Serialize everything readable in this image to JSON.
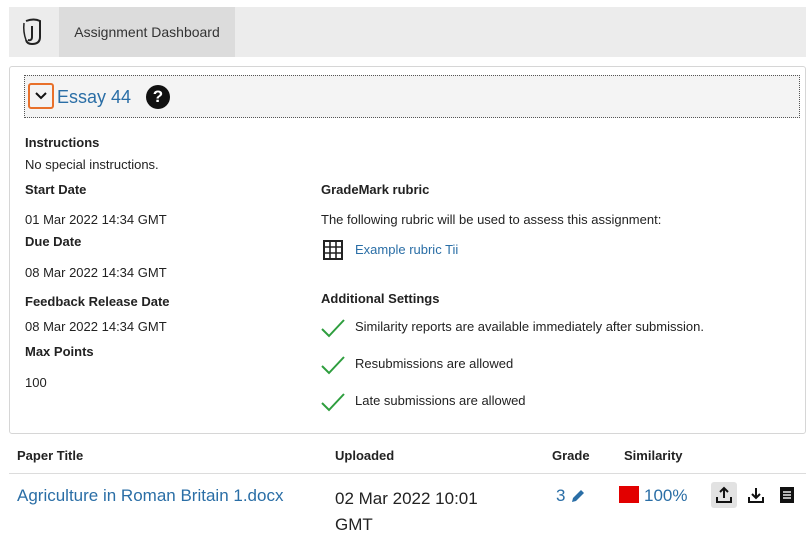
{
  "topbar": {
    "logo_icon": "turnitin-logo-icon",
    "tab_label": "Assignment Dashboard"
  },
  "assignment": {
    "title": "Essay 44",
    "collapse_icon": "chevron-down-icon",
    "help_icon": "question-circle-icon",
    "help_glyph": "?",
    "instructions_label": "Instructions",
    "instructions_text": "No special instructions.",
    "start_date_label": "Start Date",
    "start_date": "01 Mar 2022 14:34 GMT",
    "due_date_label": "Due Date",
    "due_date": "08 Mar 2022 14:34 GMT",
    "feedback_label": "Feedback Release Date",
    "feedback_date": "08 Mar 2022 14:34 GMT",
    "max_points_label": "Max Points",
    "max_points": "100",
    "rubric_label": "GradeMark rubric",
    "rubric_text": "The following rubric will be used to assess this assignment:",
    "rubric_icon": "grid-table-icon",
    "rubric_link": "Example rubric Tii",
    "settings_label": "Additional Settings",
    "settings": [
      "Similarity reports are available immediately after submission.",
      "Resubmissions are allowed",
      "Late submissions are allowed"
    ],
    "check_icon": "checkmark-icon"
  },
  "table": {
    "headers": {
      "paper_title": "Paper Title",
      "uploaded": "Uploaded",
      "grade": "Grade",
      "similarity": "Similarity"
    },
    "rows": [
      {
        "paper_title": "Agriculture in Roman Britain 1.docx",
        "uploaded": "02 Mar 2022 10:01 GMT",
        "grade": "3",
        "similarity": "100%",
        "similarity_color": "#e20000"
      }
    ],
    "action_icons": [
      "upload-icon",
      "download-icon",
      "document-list-icon"
    ]
  },
  "colors": {
    "link": "#2a6ea6",
    "accent_focus": "#e8702a",
    "check_green": "#2e9e3e"
  }
}
